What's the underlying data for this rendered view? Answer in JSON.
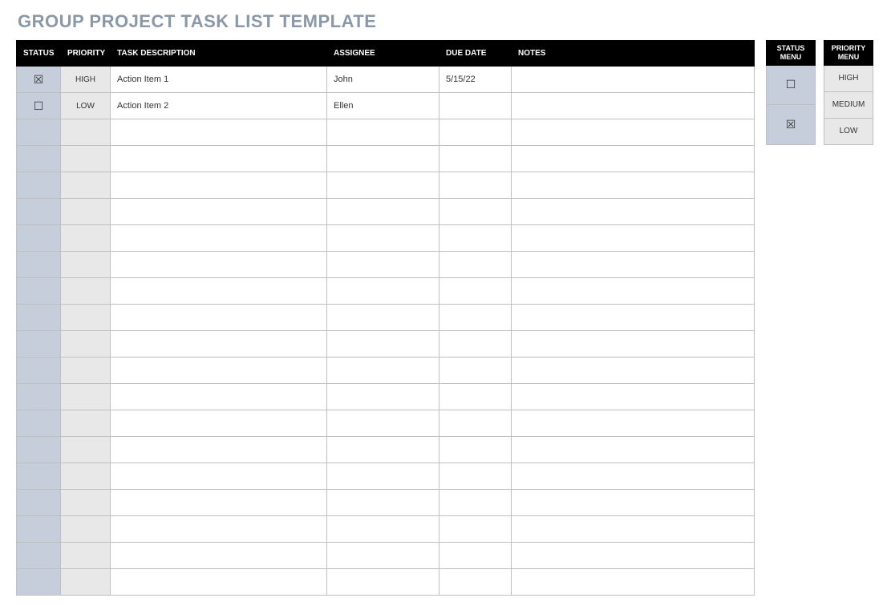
{
  "title": "GROUP PROJECT TASK LIST TEMPLATE",
  "headers": {
    "status": "STATUS",
    "priority": "PRIORITY",
    "task": "TASK DESCRIPTION",
    "assignee": "ASSIGNEE",
    "due": "DUE DATE",
    "notes": "NOTES"
  },
  "rows": [
    {
      "status": "☒",
      "priority": "HIGH",
      "task": "Action Item 1",
      "assignee": "John",
      "due": "5/15/22",
      "notes": ""
    },
    {
      "status": "☐",
      "priority": "LOW",
      "task": "Action Item 2",
      "assignee": "Ellen",
      "due": "",
      "notes": ""
    },
    {
      "status": "",
      "priority": "",
      "task": "",
      "assignee": "",
      "due": "",
      "notes": ""
    },
    {
      "status": "",
      "priority": "",
      "task": "",
      "assignee": "",
      "due": "",
      "notes": ""
    },
    {
      "status": "",
      "priority": "",
      "task": "",
      "assignee": "",
      "due": "",
      "notes": ""
    },
    {
      "status": "",
      "priority": "",
      "task": "",
      "assignee": "",
      "due": "",
      "notes": ""
    },
    {
      "status": "",
      "priority": "",
      "task": "",
      "assignee": "",
      "due": "",
      "notes": ""
    },
    {
      "status": "",
      "priority": "",
      "task": "",
      "assignee": "",
      "due": "",
      "notes": ""
    },
    {
      "status": "",
      "priority": "",
      "task": "",
      "assignee": "",
      "due": "",
      "notes": ""
    },
    {
      "status": "",
      "priority": "",
      "task": "",
      "assignee": "",
      "due": "",
      "notes": ""
    },
    {
      "status": "",
      "priority": "",
      "task": "",
      "assignee": "",
      "due": "",
      "notes": ""
    },
    {
      "status": "",
      "priority": "",
      "task": "",
      "assignee": "",
      "due": "",
      "notes": ""
    },
    {
      "status": "",
      "priority": "",
      "task": "",
      "assignee": "",
      "due": "",
      "notes": ""
    },
    {
      "status": "",
      "priority": "",
      "task": "",
      "assignee": "",
      "due": "",
      "notes": ""
    },
    {
      "status": "",
      "priority": "",
      "task": "",
      "assignee": "",
      "due": "",
      "notes": ""
    },
    {
      "status": "",
      "priority": "",
      "task": "",
      "assignee": "",
      "due": "",
      "notes": ""
    },
    {
      "status": "",
      "priority": "",
      "task": "",
      "assignee": "",
      "due": "",
      "notes": ""
    },
    {
      "status": "",
      "priority": "",
      "task": "",
      "assignee": "",
      "due": "",
      "notes": ""
    },
    {
      "status": "",
      "priority": "",
      "task": "",
      "assignee": "",
      "due": "",
      "notes": ""
    },
    {
      "status": "",
      "priority": "",
      "task": "",
      "assignee": "",
      "due": "",
      "notes": ""
    }
  ],
  "statusMenu": {
    "header": "STATUS MENU",
    "items": [
      "☐",
      "☒"
    ]
  },
  "priorityMenu": {
    "header": "PRIORITY MENU",
    "items": [
      "HIGH",
      "MEDIUM",
      "LOW"
    ]
  }
}
